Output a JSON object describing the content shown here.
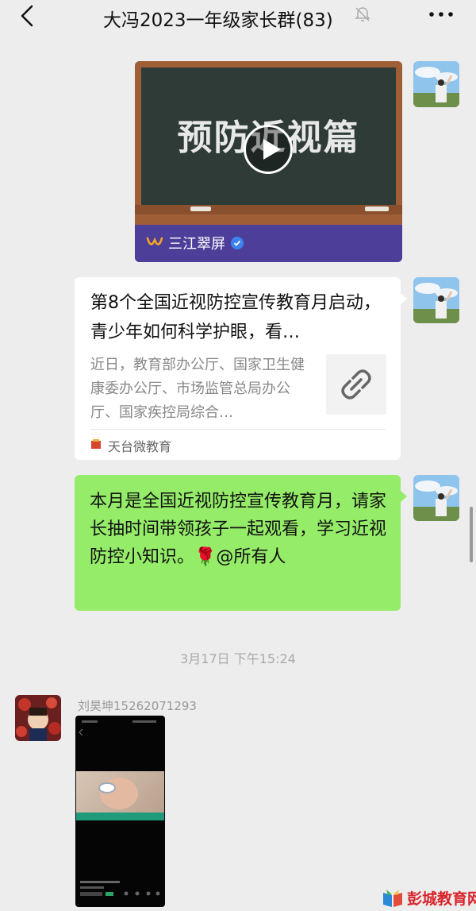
{
  "header": {
    "title": "大冯2023一年级家长群(83)",
    "back_icon": "chevron-left-icon",
    "mute_icon": "bell-off-icon",
    "more_icon": "more-horizontal-icon"
  },
  "messages": {
    "video": {
      "cover_text": "预防近视篇",
      "source": "三江翠屏"
    },
    "link": {
      "title": "第8个全国近视防控宣传教育月启动，青少年如何科学护眼，看…",
      "description": "近日，教育部办公厅、国家卫生健康委办公厅、市场监管总局办公厅、国家疾控局综合…",
      "source": "天台微教育"
    },
    "text": {
      "content": "本月是全国近视防控宣传教育月，请家长抽时间带领孩子一起观看，学习近视防控小知识。🌹@所有人"
    },
    "timestamp": "3月17日 下午15:24",
    "incoming": {
      "sender": "刘昊坤15262071293"
    }
  },
  "watermark": {
    "text": "彭城教育网"
  },
  "colors": {
    "background": "#ededed",
    "sent_bubble": "#95ec69",
    "video_bar": "#4c3e99",
    "watermark": "#d8232a"
  }
}
